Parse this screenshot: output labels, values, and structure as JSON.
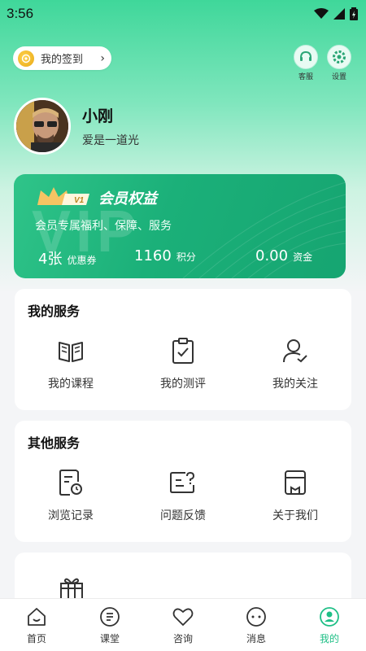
{
  "status_bar": {
    "time": "3:56"
  },
  "header": {
    "signin_label": "我的签到",
    "actions": [
      {
        "label": "客服",
        "icon": "customer-service-icon"
      },
      {
        "label": "设置",
        "icon": "settings-icon"
      }
    ]
  },
  "profile": {
    "name": "小刚",
    "motto": "爱是一道光"
  },
  "vip": {
    "watermark": "VIP",
    "level_badge": "V1",
    "title": "会员权益",
    "subtitle": "会员专属福利、保障、服务",
    "stats": [
      {
        "value": "4张",
        "unit": "优惠券"
      },
      {
        "value": "1160",
        "unit": "积分"
      },
      {
        "value": "0.00",
        "unit": "资金"
      }
    ]
  },
  "my_services": {
    "title": "我的服务",
    "items": [
      {
        "label": "我的课程",
        "icon": "book-icon"
      },
      {
        "label": "我的测评",
        "icon": "clipboard-check-icon"
      },
      {
        "label": "我的关注",
        "icon": "user-follow-icon"
      }
    ]
  },
  "other_services": {
    "title": "其他服务",
    "items": [
      {
        "label": "浏览记录",
        "icon": "history-icon"
      },
      {
        "label": "问题反馈",
        "icon": "feedback-icon"
      },
      {
        "label": "关于我们",
        "icon": "about-icon"
      }
    ]
  },
  "tab_bar": {
    "tabs": [
      {
        "label": "首页",
        "icon": "home-icon"
      },
      {
        "label": "课堂",
        "icon": "classroom-icon"
      },
      {
        "label": "咨询",
        "icon": "heart-icon"
      },
      {
        "label": "消息",
        "icon": "message-icon"
      },
      {
        "label": "我的",
        "icon": "profile-icon",
        "active": true
      }
    ]
  },
  "colors": {
    "accent": "#1fbf86",
    "vip_card": "#1bb079"
  }
}
